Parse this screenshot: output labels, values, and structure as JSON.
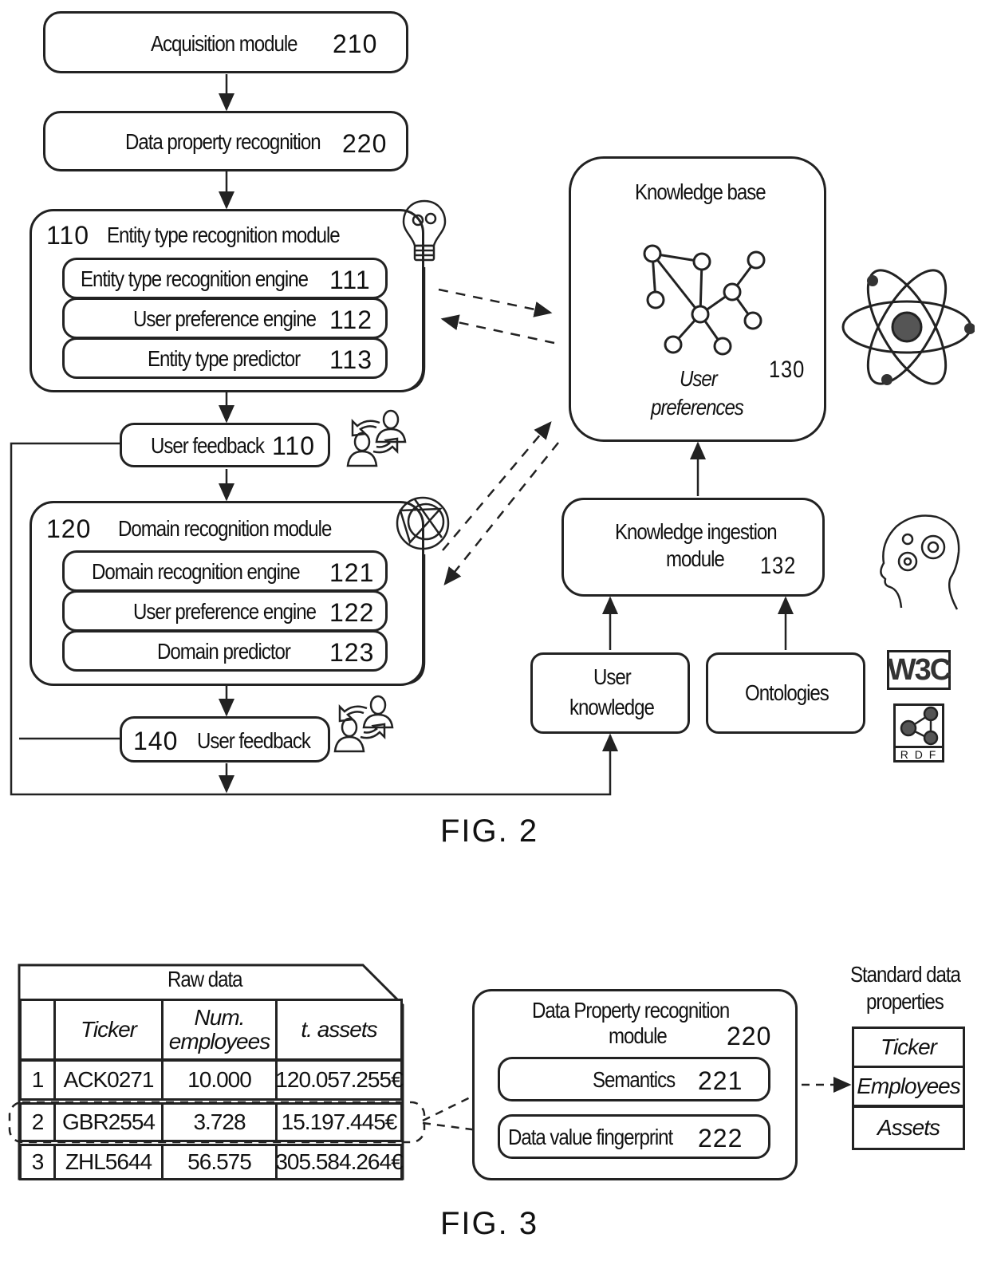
{
  "fig2": {
    "caption": "FIG. 2",
    "acquisition": {
      "label": "Acquisition module",
      "ref": "210"
    },
    "data_property": {
      "label": "Data property recognition",
      "ref": "220"
    },
    "entity_module": {
      "ref": "110",
      "label": "Entity type recognition module",
      "items": [
        {
          "label": "Entity type recognition engine",
          "ref": "111"
        },
        {
          "label": "User preference engine",
          "ref": "112"
        },
        {
          "label": "Entity type predictor",
          "ref": "113"
        }
      ]
    },
    "feedback_1": {
      "label": "User feedback",
      "ref": "110"
    },
    "domain_module": {
      "ref": "120",
      "label": "Domain recognition module",
      "items": [
        {
          "label": "Domain recognition engine",
          "ref": "121"
        },
        {
          "label": "User preference engine",
          "ref": "122"
        },
        {
          "label": "Domain predictor",
          "ref": "123"
        }
      ]
    },
    "feedback_2": {
      "label": "User feedback",
      "ref": "140"
    },
    "knowledge_base": {
      "title": "Knowledge base",
      "subtitle": "User preferences",
      "subtitle_line1": "User",
      "subtitle_line2": "preferences",
      "ref": "130"
    },
    "ingestion": {
      "line1": "Knowledge ingestion",
      "line2": "module",
      "ref": "132"
    },
    "user_knowledge": {
      "line1": "User",
      "line2": "knowledge"
    },
    "ontologies": {
      "label": "Ontologies"
    },
    "logos": {
      "w3c": "W3C",
      "rdf": "R D F"
    },
    "icons": [
      "lightbulb-gears-icon",
      "users-exchange-icon",
      "globe-network-icon",
      "atom-globe-icon",
      "head-gears-icon",
      "w3c-logo",
      "rdf-logo",
      "knowledge-graph-icon"
    ]
  },
  "fig3": {
    "caption": "FIG. 3",
    "raw_data": {
      "title": "Raw data",
      "headers": [
        "",
        "Ticker",
        "Num. employees",
        "t. assets"
      ],
      "header_num_line1": "Num.",
      "header_num_line2": "employees",
      "rows": [
        [
          "1",
          "ACK0271",
          "10.000",
          "120.057.255€"
        ],
        [
          "2",
          "GBR2554",
          "3.728",
          "15.197.445€"
        ],
        [
          "3",
          "ZHL5644",
          "56.575",
          "305.584.264€"
        ]
      ]
    },
    "dpr_module": {
      "line1": "Data Property recognition",
      "line2": "module",
      "ref": "220",
      "items": [
        {
          "label": "Semantics",
          "ref": "221"
        },
        {
          "label": "Data value fingerprint",
          "ref": "222"
        }
      ]
    },
    "standard": {
      "title_line1": "Standard data",
      "title_line2": "properties",
      "items": [
        "Ticker",
        "Employees",
        "Assets"
      ]
    }
  }
}
